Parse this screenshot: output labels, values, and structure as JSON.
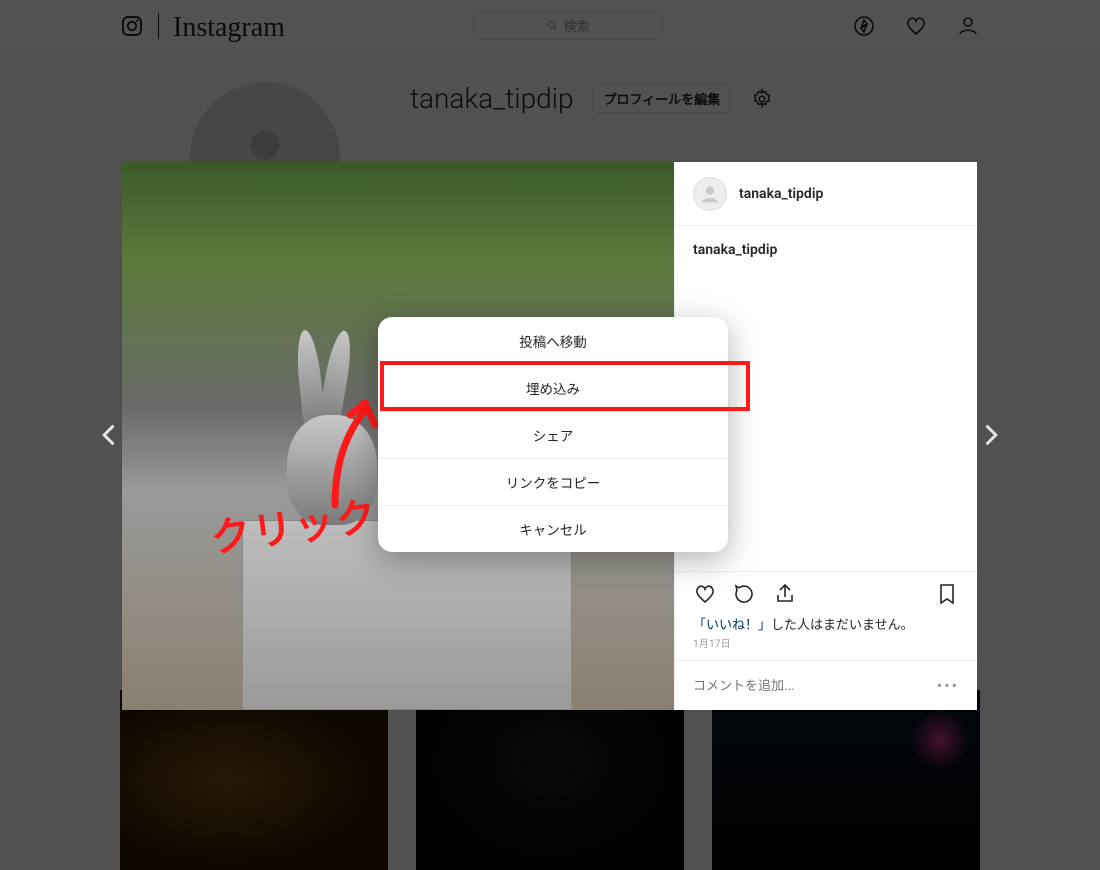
{
  "header": {
    "wordmark": "Instagram",
    "search_placeholder": "検索"
  },
  "profile": {
    "username": "tanaka_tipdip",
    "edit_label": "プロフィールを編集"
  },
  "post": {
    "author": "tanaka_tipdip",
    "caption_author": "tanaka_tipdip",
    "likes_text_prefix": "「いいね！」",
    "likes_text_rest": "した人はまだいません。",
    "date": "1月17日",
    "comment_placeholder": "コメントを追加..."
  },
  "sheet": {
    "items": [
      "投稿へ移動",
      "埋め込み",
      "シェア",
      "リンクをコピー",
      "キャンセル"
    ]
  },
  "annotation": {
    "text": "クリック"
  }
}
